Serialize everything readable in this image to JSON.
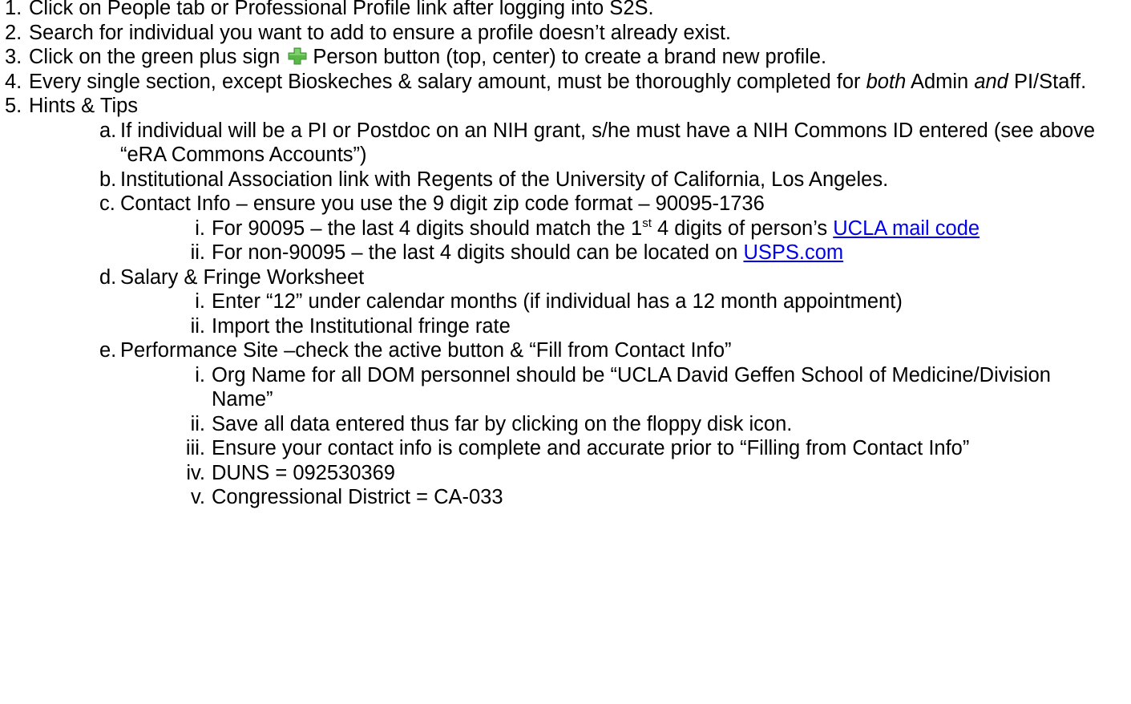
{
  "items": [
    {
      "marker": "1.",
      "text": "Click on People tab or Professional Profile link after logging into S2S."
    },
    {
      "marker": "2.",
      "text": "Search for individual you want to add to ensure a profile doesn’t already exist."
    },
    {
      "marker": "3.",
      "text_before": "Click on the green plus sign",
      "icon": "green-plus-icon",
      "text_after": "Person button (top, center) to create a brand new profile."
    },
    {
      "marker": "4.",
      "text_1": "Every single section, except Bioskeches & salary amount, must be thoroughly completed for",
      "italic_1": "both",
      "text_2": " Admin ",
      "italic_2": "and",
      "text_3": " PI/Staff."
    },
    {
      "marker": "5.",
      "text": "Hints & Tips"
    }
  ],
  "hints": {
    "a": {
      "marker": "a.",
      "text": "If individual will be a PI or Postdoc on an NIH grant, s/he must have a NIH Commons ID entered (see above “eRA Commons Accounts”)"
    },
    "b": {
      "marker": "b.",
      "text": "Institutional Association link with Regents of the University of California, Los Angeles."
    },
    "c": {
      "marker": "c.",
      "text": "Contact Info – ensure you use the 9 digit zip code format – 90095-1736",
      "sub": {
        "i": {
          "marker": "i.",
          "text_before": "For 90095 – the last 4 digits should match the 1",
          "sup": "st",
          "text_after": " 4 digits of person’s ",
          "link": "UCLA mail code"
        },
        "ii": {
          "marker": "ii.",
          "text_before": "For non-90095 – the last 4 digits should can be located on ",
          "link": "USPS.com"
        }
      }
    },
    "d": {
      "marker": "d.",
      "text": "Salary & Fringe Worksheet",
      "sub": {
        "i": {
          "marker": "i.",
          "text": "Enter “12” under calendar months (if individual has a 12 month appointment)"
        },
        "ii": {
          "marker": "ii.",
          "text": "Import the Institutional fringe rate"
        }
      }
    },
    "e": {
      "marker": "e.",
      "text": "Performance Site –check the active button & “Fill from Contact Info”",
      "sub": {
        "i": {
          "marker": "i.",
          "text": "Org Name for all DOM personnel should be “UCLA David Geffen School of Medicine/Division Name”"
        },
        "ii": {
          "marker": "ii.",
          "text": "Save all data entered thus far by clicking on the floppy disk icon."
        },
        "iii": {
          "marker": "iii.",
          "text": "Ensure your contact info is complete and accurate prior to “Filling from Contact Info”"
        },
        "iv": {
          "marker": "iv.",
          "text": "DUNS = 092530369"
        },
        "v": {
          "marker": "v.",
          "text": "Congressional District = CA-033"
        }
      }
    }
  },
  "colors": {
    "link": "#0000ee",
    "plus_icon": "#58b947"
  }
}
